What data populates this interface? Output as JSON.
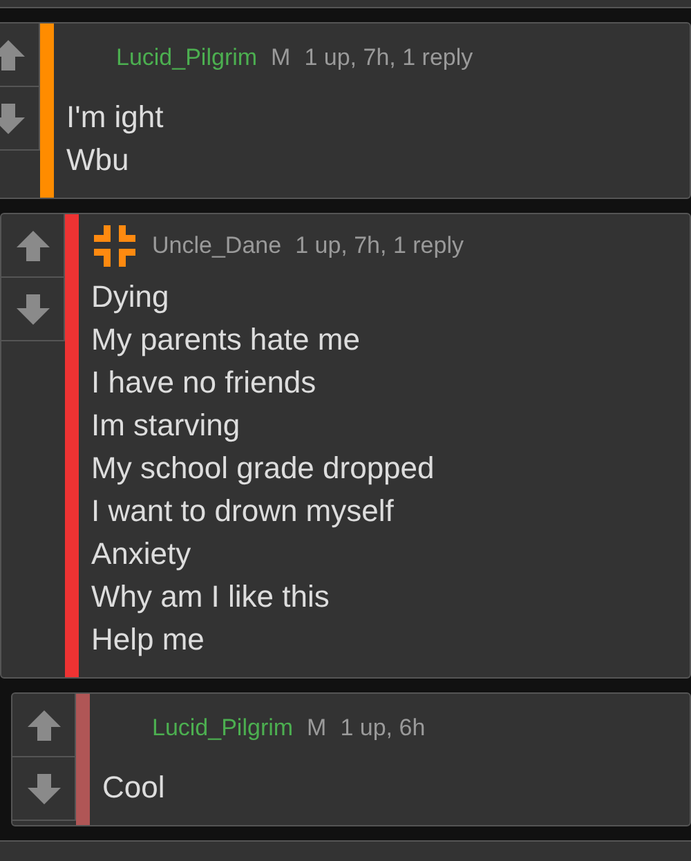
{
  "comments": [
    {
      "username": "Lucid_Pilgrim",
      "highlighted": true,
      "badge": "M",
      "avatar": false,
      "meta": "1 up, 7h, 1 reply",
      "color": "#ff8c00",
      "lines": [
        "I'm ight",
        "Wbu"
      ]
    },
    {
      "username": "Uncle_Dane",
      "highlighted": false,
      "avatar": true,
      "meta": "1 up, 7h, 1 reply",
      "color": "#ee3333",
      "lines": [
        "Dying",
        "My parents hate me",
        "I have no friends",
        "Im starving",
        "My school grade dropped",
        "I want to drown myself",
        "Anxiety",
        "Why am I like this",
        "Help me"
      ]
    },
    {
      "username": "Lucid_Pilgrim",
      "highlighted": true,
      "badge": "M",
      "avatar": false,
      "meta": "1 up, 6h",
      "color": "#b05656",
      "lines": [
        "Cool"
      ]
    }
  ]
}
